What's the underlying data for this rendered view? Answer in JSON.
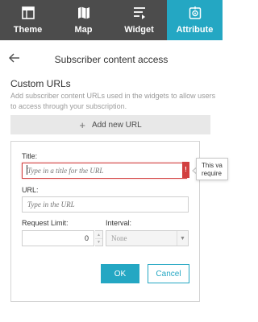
{
  "tabs": [
    {
      "label": "Theme",
      "icon": "theme-icon",
      "active": false
    },
    {
      "label": "Map",
      "icon": "map-icon",
      "active": false
    },
    {
      "label": "Widget",
      "icon": "widget-icon",
      "active": false
    },
    {
      "label": "Attribute",
      "icon": "attribute-icon",
      "active": true
    }
  ],
  "header": {
    "title": "Subscriber content access",
    "back_icon": "back-arrow-icon"
  },
  "section": {
    "title": "Custom URLs",
    "description": "Add subscriber content URLs used in the widgets to allow users to access through your subscription."
  },
  "add_button": {
    "label": "Add new URL",
    "icon": "plus-icon"
  },
  "form": {
    "title_label": "Title:",
    "title_placeholder": "Type in a title for the URL",
    "title_value": "",
    "url_label": "URL:",
    "url_placeholder": "Type in the URL",
    "url_value": "",
    "request_limit_label": "Request Limit:",
    "request_limit_value": "0",
    "interval_label": "Interval:",
    "interval_value": "None",
    "ok_label": "OK",
    "cancel_label": "Cancel",
    "error_mark": "!"
  },
  "tooltip": {
    "line1": "This va",
    "line2": "require"
  },
  "colors": {
    "accent": "#24a7c3",
    "tabbar": "#4c4c4c",
    "error": "#d23f3f"
  }
}
